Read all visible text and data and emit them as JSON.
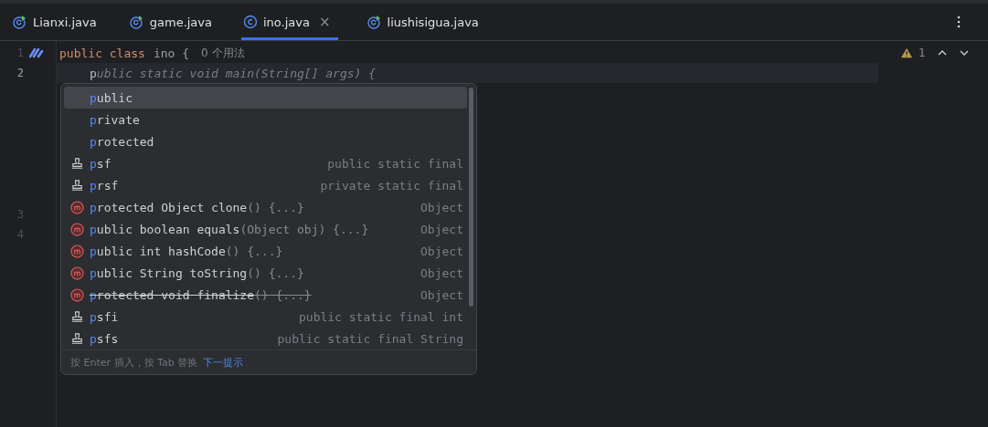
{
  "tabs": [
    {
      "label": "Lianxi.java",
      "kind": "runnable",
      "selected": false,
      "closable": false
    },
    {
      "label": "game.java",
      "kind": "runnable",
      "selected": false,
      "closable": false
    },
    {
      "label": "ino.java",
      "kind": "class",
      "selected": true,
      "closable": true
    },
    {
      "label": "liushisigua.java",
      "kind": "runnable",
      "selected": false,
      "closable": false
    }
  ],
  "close_glyph": "×",
  "gutter": [
    {
      "number": "1",
      "current": false,
      "marker": true
    },
    {
      "number": "2",
      "current": true,
      "marker": false
    },
    {
      "number": "3",
      "current": false,
      "marker": false
    },
    {
      "number": "4",
      "current": false,
      "marker": false
    }
  ],
  "code": [
    {
      "kind": "class-line",
      "tokens": [
        {
          "kind": "keyword",
          "text": "public class"
        },
        {
          "kind": "plain",
          "text": "ino {"
        }
      ],
      "inlay": "0 个用法"
    },
    {
      "kind": "typing-line",
      "text": "public static void main(String[] args) {"
    }
  ],
  "inspection": {
    "count": "1"
  },
  "completion": {
    "items": [
      {
        "kind": "keyword",
        "label": "public",
        "selected": true
      },
      {
        "kind": "keyword",
        "label": "private",
        "selected": false
      },
      {
        "kind": "keyword",
        "label": "protected",
        "selected": false
      },
      {
        "kind": "template",
        "label": "psf",
        "type": "public static final",
        "selected": false
      },
      {
        "kind": "template",
        "label": "prsf",
        "type": "private static final",
        "selected": false
      },
      {
        "kind": "method",
        "label": "protected Object clone",
        "params": "() {...}",
        "type": "Object",
        "deprecated": false,
        "selected": false
      },
      {
        "kind": "method",
        "label": "public boolean equals",
        "params": "(Object obj) {...}",
        "type": "Object",
        "deprecated": false,
        "selected": false
      },
      {
        "kind": "method",
        "label": "public int hashCode",
        "params": "() {...}",
        "type": "Object",
        "deprecated": false,
        "selected": false
      },
      {
        "kind": "method",
        "label": "public String toString",
        "params": "() {...}",
        "type": "Object",
        "deprecated": false,
        "selected": false
      },
      {
        "kind": "method",
        "label": "protected void finalize",
        "params": "() {...}",
        "type": "Object",
        "deprecated": true,
        "selected": false
      },
      {
        "kind": "template",
        "label": "psfi",
        "type": "public static final int",
        "selected": false
      },
      {
        "kind": "template",
        "label": "psfs",
        "type": "public static final String",
        "selected": false
      }
    ],
    "hint": "按 Enter 插入，按 Tab 替换",
    "hint_link": "下一提示"
  }
}
